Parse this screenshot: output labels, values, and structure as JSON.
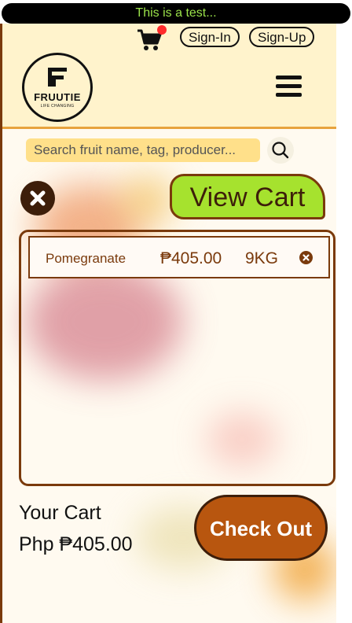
{
  "banner": {
    "text": "This is a test..."
  },
  "colors": {
    "accent": "#a6e22e",
    "brand_dark": "#7a3a0c",
    "checkout": "#b8560f",
    "header_bg": "#fff3cc",
    "search_bg": "#ffe08a",
    "notification": "#ff2b2b"
  },
  "header": {
    "cart_icon": "shopping-cart-icon",
    "signin_label": "Sign-In",
    "signup_label": "Sign-Up",
    "logo_name": "FRUUTIE",
    "logo_tagline": "LIFE CHANGING",
    "menu_icon": "hamburger-menu-icon"
  },
  "search": {
    "placeholder": "Search fruit name, tag, producer...",
    "icon": "search-icon"
  },
  "cart": {
    "close_icon": "close-icon",
    "title": "View Cart",
    "items": [
      {
        "name": "Pomegranate",
        "price": "₱405.00",
        "quantity": "9KG",
        "remove_icon": "remove-icon"
      }
    ],
    "total_label": "Your Cart",
    "total_value": "Php ₱405.00",
    "checkout_label": "Check Out"
  }
}
